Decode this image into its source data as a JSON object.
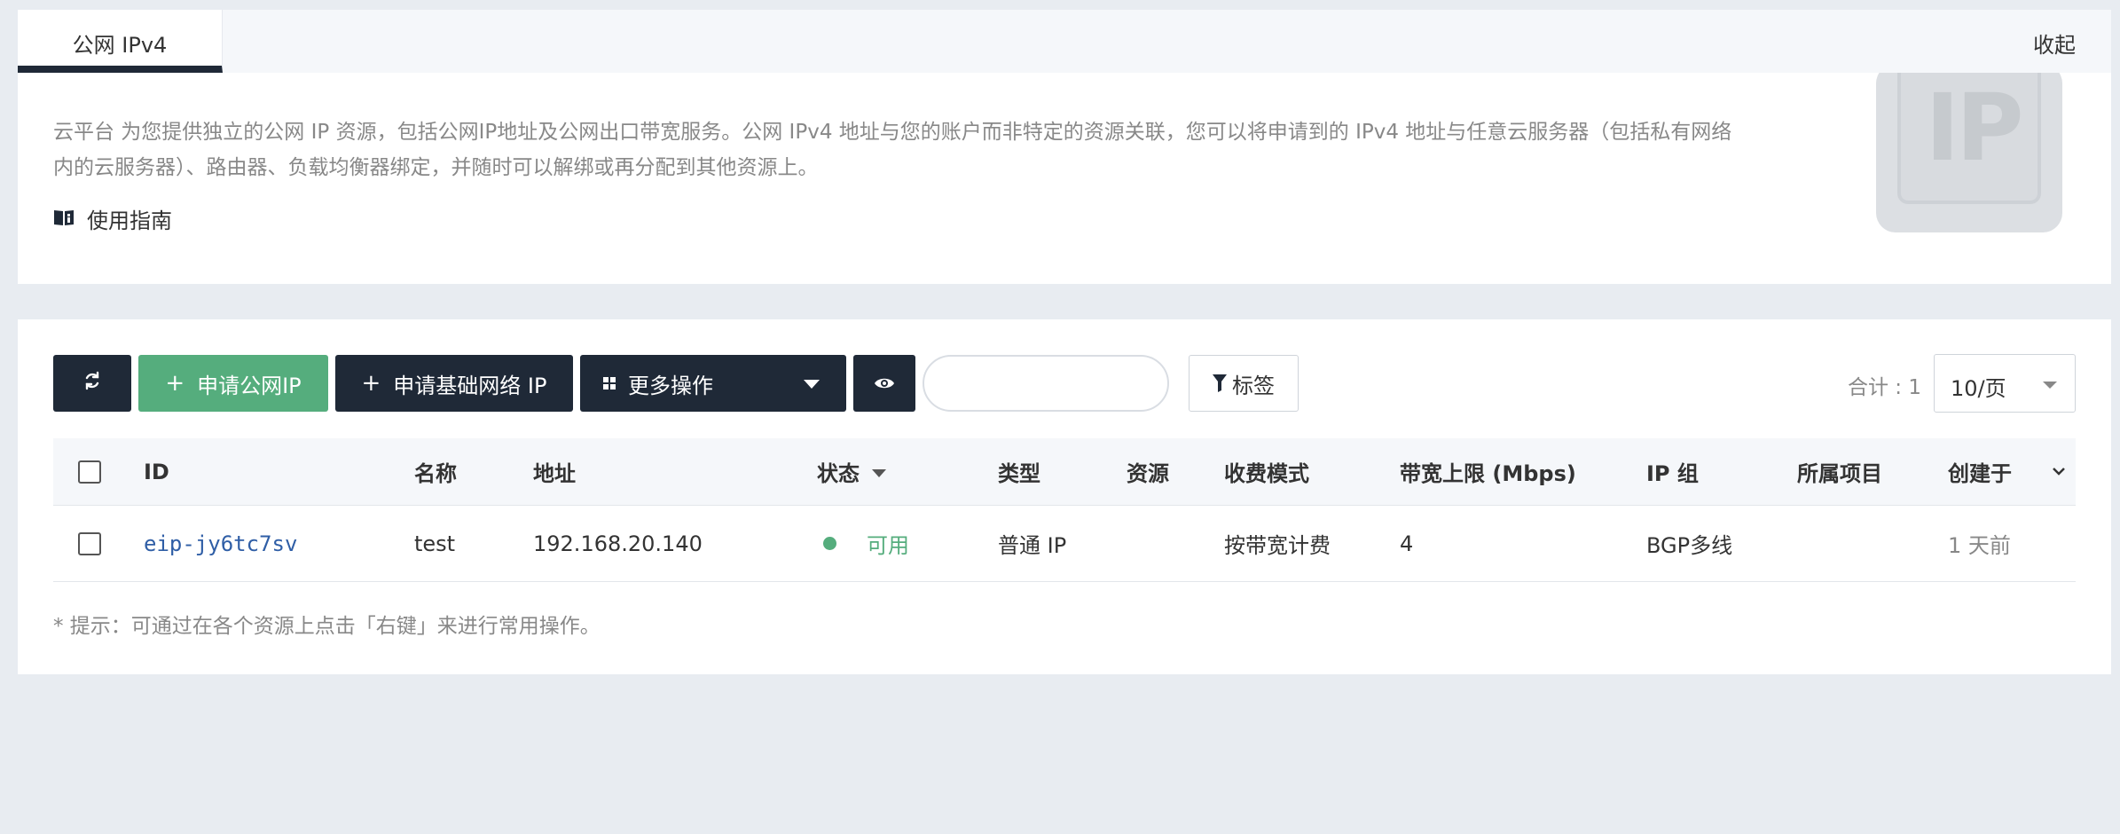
{
  "tabs": {
    "active": "公网 IPv4",
    "collapse": "收起"
  },
  "intro": {
    "description": "云平台 为您提供独立的公网 IP 资源，包括公网IP地址及公网出口带宽服务。公网 IPv4 地址与您的账户而非特定的资源关联，您可以将申请到的 IPv4 地址与任意云服务器（包括私有网络内的云服务器）、路由器、负载均衡器绑定，并随时可以解绑或再分配到其他资源上。",
    "guide": "使用指南",
    "badge_text": "IP"
  },
  "toolbar": {
    "apply_public_ip": "申请公网IP",
    "apply_basic_ip": "申请基础网络 IP",
    "more_actions": "更多操作",
    "search_placeholder": "",
    "tag_filter": "标签",
    "total": "合计 : 1",
    "page_size": "10/页"
  },
  "table": {
    "columns": {
      "id": "ID",
      "name": "名称",
      "address": "地址",
      "status": "状态",
      "type": "类型",
      "resource": "资源",
      "billing": "收费模式",
      "bandwidth": "带宽上限 (Mbps)",
      "ip_group": "IP 组",
      "project": "所属项目",
      "created": "创建于"
    },
    "rows": [
      {
        "id": "eip-jy6tc7sv",
        "name": "test",
        "address": "192.168.20.140",
        "status": "可用",
        "type": "普通 IP",
        "resource": "",
        "billing": "按带宽计费",
        "bandwidth": "4",
        "ip_group": "BGP多线",
        "project": "",
        "created": "1 天前"
      }
    ]
  },
  "hint": "* 提示：可通过在各个资源上点击「右键」来进行常用操作。",
  "colors": {
    "dark": "#1f2937",
    "green": "#55ad7d",
    "link": "#2f5ea6"
  },
  "icons": [
    "refresh-icon",
    "plus-icon",
    "grid-icon",
    "caret-down-icon",
    "eye-icon",
    "filter-icon",
    "book-icon",
    "chevron-down-icon"
  ]
}
